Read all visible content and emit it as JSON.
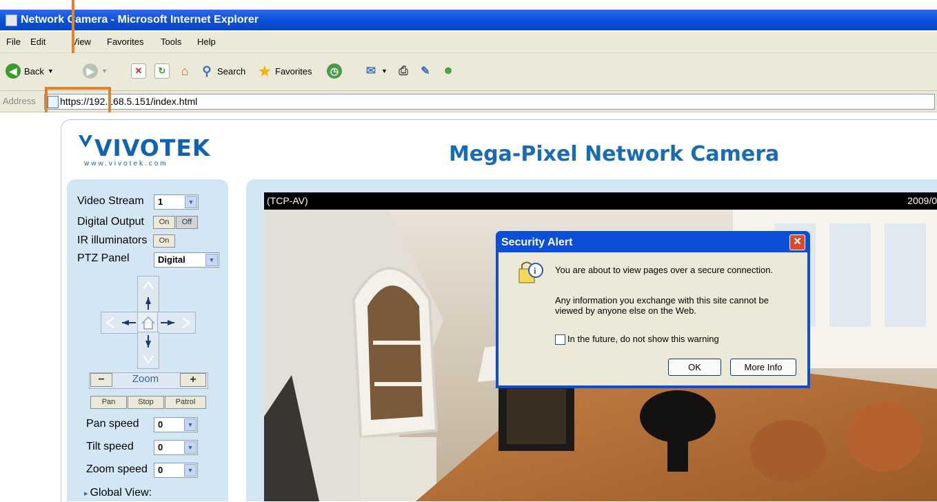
{
  "window": {
    "title": "Network Camera - Microsoft Internet Explorer"
  },
  "menu": {
    "items": [
      "File",
      "Edit",
      "View",
      "Favorites",
      "Tools",
      "Help"
    ]
  },
  "toolbar": {
    "back_label": "Back",
    "search_label": "Search",
    "favorites_label": "Favorites"
  },
  "address": {
    "label": "Address",
    "url": "https://192.168.5.151/index.html"
  },
  "page": {
    "logo_text": "VIVOTEK",
    "logo_subtext": "www.vivotek.com",
    "title": "Mega-Pixel Network Camera"
  },
  "controls": {
    "video_stream_label": "Video Stream",
    "video_stream_value": "1",
    "digital_output_label": "Digital Output",
    "on_label": "On",
    "off_label": "Off",
    "ir_label": "IR illuminators",
    "ptz_panel_label": "PTZ Panel",
    "ptz_panel_value": "Digital",
    "zoom_label": "Zoom",
    "zoom_minus": "−",
    "zoom_plus": "+",
    "pan_button": "Pan",
    "stop_button": "Stop",
    "patrol_button": "Patrol",
    "pan_speed_label": "Pan speed",
    "pan_speed_value": "0",
    "tilt_speed_label": "Tilt speed",
    "tilt_speed_value": "0",
    "zoom_speed_label": "Zoom speed",
    "zoom_speed_value": "0",
    "global_view_label": "Global View:"
  },
  "video": {
    "protocol": "(TCP-AV)",
    "timestamp": "2009/0"
  },
  "dialog": {
    "title": "Security Alert",
    "line1": "You are about to view pages over a secure connection.",
    "line2": "Any information you exchange with this site cannot be",
    "line3": "viewed by anyone else on the Web.",
    "checkbox_label": "In the future, do not show this warning",
    "ok_label": "OK",
    "more_info_label": "More Info",
    "close_glyph": "✕"
  }
}
